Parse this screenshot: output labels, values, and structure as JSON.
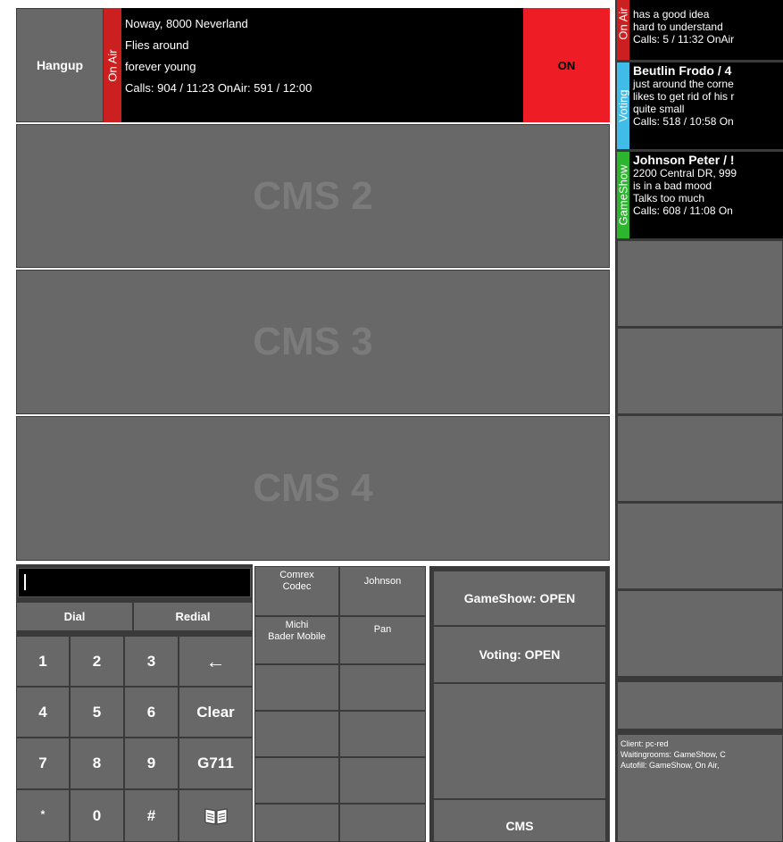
{
  "top_call": {
    "hangup_label": "Hangup",
    "status_tab": "On Air",
    "lines": [
      "Noway, 8000 Neverland",
      "Flies around",
      "forever young",
      "Calls: 904 / 11:23  OnAir: 591 / 12:00"
    ],
    "on_label": "ON"
  },
  "cms_panels": [
    "CMS 2",
    "CMS 3",
    "CMS 4"
  ],
  "dialer": {
    "input_value": "",
    "dial_label": "Dial",
    "redial_label": "Redial",
    "keys": [
      "1",
      "2",
      "3",
      "←",
      "4",
      "5",
      "6",
      "Clear",
      "7",
      "8",
      "9",
      "G711",
      "*",
      "0",
      "#",
      "book-icon"
    ]
  },
  "speed_dial": {
    "buttons": [
      "Comrex\nCodec",
      "Johnson",
      "Michi\nBader Mobile",
      "Pan",
      "",
      "",
      "",
      "",
      "",
      "",
      "",
      ""
    ]
  },
  "actions": {
    "gameshow_label": "GameShow: OPEN",
    "voting_label": "Voting: OPEN",
    "cms_label": "CMS"
  },
  "queue": [
    {
      "tab": "On Air",
      "tab_color": "#cc1f1f",
      "name": "",
      "lines": [
        "has a good idea",
        "hard to understand",
        "Calls: 5 / 11:32  OnAir"
      ]
    },
    {
      "tab": "Voting",
      "tab_color": "#3fbde8",
      "name": "Beutlin Frodo / 4",
      "lines": [
        "just around the corne",
        "likes to get rid of his r",
        "quite small",
        "Calls: 518 / 10:58  On"
      ]
    },
    {
      "tab": "GameShow",
      "tab_color": "#2db52d",
      "name": "Johnson Peter / !",
      "lines": [
        "2200 Central DR, 999",
        "is in a bad mood",
        "Talks too much",
        "Calls: 608 / 11:08  On"
      ]
    }
  ],
  "status_box": {
    "client": "Client: pc-red",
    "waitingrooms": "Waitingrooms: GameShow, C",
    "autofill": "Autofill: GameShow, On Air, "
  },
  "colors": {
    "panel": "#686868",
    "border": "#3a3a3a",
    "on_red": "#ee1c24",
    "onair_tab": "#cc1f1f"
  }
}
